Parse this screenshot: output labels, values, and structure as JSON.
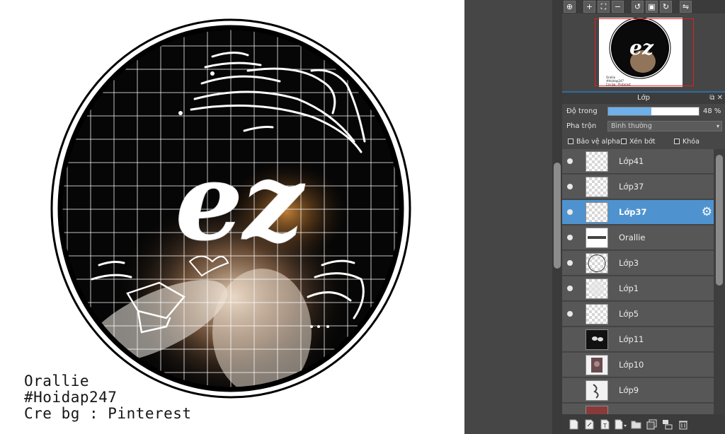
{
  "artwork": {
    "logo_text": "ez",
    "caption_lines": [
      "Orallie",
      "#Hoidap247",
      "Cre bg : Pinterest"
    ]
  },
  "top_toolbar": {
    "buttons": [
      {
        "name": "zoom-reset-icon",
        "glyph": "⊕"
      },
      {
        "name": "zoom-in-icon",
        "glyph": "+"
      },
      {
        "name": "fit-screen-icon",
        "glyph": "⛶"
      },
      {
        "name": "zoom-out-icon",
        "glyph": "−"
      },
      {
        "name": "rotate-left-icon",
        "glyph": "↺"
      },
      {
        "name": "actual-size-icon",
        "glyph": "▣"
      },
      {
        "name": "rotate-right-icon",
        "glyph": "↻"
      },
      {
        "name": "flip-horizontal-icon",
        "glyph": "⇋"
      }
    ]
  },
  "layer_panel": {
    "title": "Lớp",
    "opacity_label": "Độ trong",
    "opacity_percent": 48,
    "opacity_text": "48 %",
    "blend_label": "Pha trộn",
    "blend_value": "Bình thường",
    "checks": {
      "protect_alpha": "Bảo vệ alpha",
      "clipping": "Xén bớt",
      "lock": "Khóa"
    },
    "layers": [
      {
        "name": "Lớp41",
        "visible": true,
        "selected": false,
        "thumb": "checker"
      },
      {
        "name": "Lớp37",
        "visible": true,
        "selected": false,
        "thumb": "checker"
      },
      {
        "name": "Lớp37",
        "visible": true,
        "selected": true,
        "thumb": "checker"
      },
      {
        "name": "Orallie",
        "visible": true,
        "selected": false,
        "thumb": "text"
      },
      {
        "name": "Lớp3",
        "visible": true,
        "selected": false,
        "thumb": "circle"
      },
      {
        "name": "Lớp1",
        "visible": true,
        "selected": false,
        "thumb": "faint"
      },
      {
        "name": "Lớp5",
        "visible": true,
        "selected": false,
        "thumb": "checker"
      },
      {
        "name": "Lớp11",
        "visible": false,
        "selected": false,
        "thumb": "dark"
      },
      {
        "name": "Lớp10",
        "visible": false,
        "selected": false,
        "thumb": "photo"
      },
      {
        "name": "Lớp9",
        "visible": false,
        "selected": false,
        "thumb": "sketch"
      },
      {
        "name": "",
        "visible": false,
        "selected": false,
        "thumb": "partial"
      }
    ]
  },
  "bottom_toolbar": {
    "buttons": [
      "new-layer-icon",
      "new-vector-layer-icon",
      "new-text-layer-icon",
      "add-layer-menu-icon",
      "new-folder-icon",
      "duplicate-layer-icon",
      "merge-down-icon",
      "delete-layer-icon"
    ]
  }
}
